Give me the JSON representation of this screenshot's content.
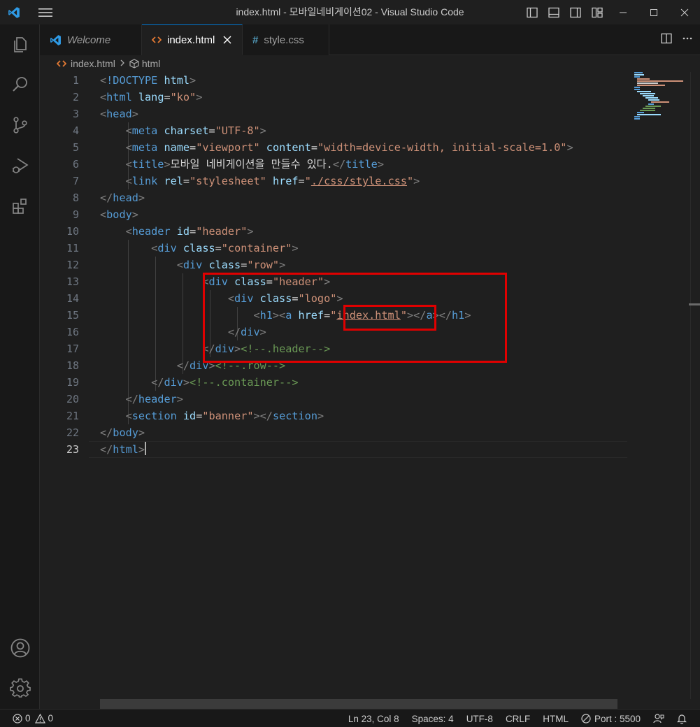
{
  "window": {
    "title": "index.html - 모바일네비게이션02 - Visual Studio Code"
  },
  "tabs": [
    {
      "label": "Welcome",
      "icon": "vscode-icon",
      "italic": true
    },
    {
      "label": "index.html",
      "icon": "html-icon",
      "active": true
    },
    {
      "label": "style.css",
      "icon": "css-hash-icon"
    }
  ],
  "breadcrumb": {
    "file": "index.html",
    "symbol": "html"
  },
  "editor": {
    "line_numbers": [
      "1",
      "2",
      "3",
      "4",
      "5",
      "6",
      "7",
      "8",
      "9",
      "10",
      "11",
      "12",
      "13",
      "14",
      "15",
      "16",
      "17",
      "18",
      "19",
      "20",
      "21",
      "22",
      "23"
    ],
    "active_line": "23",
    "strings": {
      "doctype": "<!DOCTYPE",
      "html_kw": "html",
      "lang_val": "\"ko\"",
      "charset_val": "\"UTF-8\"",
      "viewport_val": "\"viewport\"",
      "content_val": "\"width=device-width, initial-scale=1.0\"",
      "title_text": "모바일 네비게이션을 만들수 있다.",
      "stylesheet_val": "\"stylesheet\"",
      "css_href": "./css/style.css",
      "header_id": "\"header\"",
      "container_val": "\"container\"",
      "row_val": "\"row\"",
      "header_class": "\"header\"",
      "logo_val": "\"logo\"",
      "index_href": "index.html",
      "comment_header": "<!--.header-->",
      "comment_row": "<!--.row-->",
      "comment_container": "<!--.container-->",
      "banner_val": "\"banner\""
    }
  },
  "statusbar": {
    "errors": "0",
    "warnings": "0",
    "position": "Ln 23, Col 8",
    "spaces": "Spaces: 4",
    "encoding": "UTF-8",
    "eol": "CRLF",
    "language": "HTML",
    "port": "Port : 5500"
  },
  "colors": {
    "accent": "#0078d4",
    "highlight": "#e00000",
    "tag": "#569cd6",
    "attribute": "#9cdcfe",
    "string": "#ce9178",
    "comment": "#6a9955"
  }
}
